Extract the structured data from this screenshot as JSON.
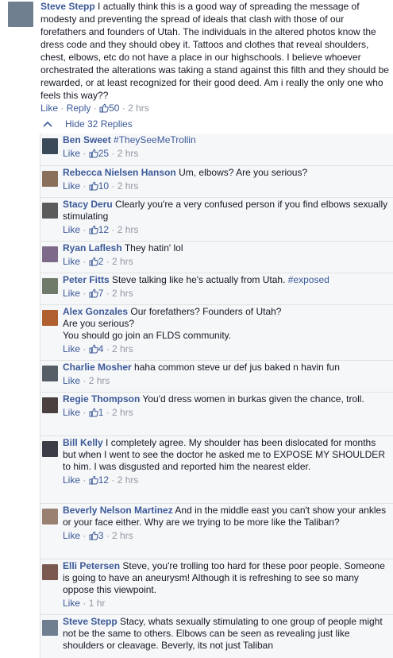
{
  "main_comment": {
    "author": "Steve Stepp",
    "text": "I actually think this is a good way of spreading the message of modesty and preventing the spread of ideals that clash with those of our forefathers and founders of Utah. The individuals in the altered photos know the dress code and they should obey it. Tattoos and clothes that reveal shoulders, chest, elbows, etc do not have a place in our highschools. I believe whoever orchestrated the alterations was taking a stand against this filth and they should be rewarded, or at least recognized for their good deed. Am i really the only one who feels this way??",
    "like_label": "Like",
    "reply_label": "Reply",
    "likes": "50",
    "time": "2 hrs"
  },
  "hide_replies_label": "Hide 32 Replies",
  "replies": [
    {
      "author": "Ben Sweet",
      "text": "",
      "hashtag": "#TheySeeMeTrollin",
      "like_label": "Like",
      "likes": "25",
      "time": "2 hrs",
      "avatar_color": "#3a4a58"
    },
    {
      "author": "Rebecca Nielsen Hanson",
      "text": "Um, elbows? Are you serious?",
      "hashtag": "",
      "like_label": "Like",
      "likes": "10",
      "time": "2 hrs",
      "avatar_color": "#8a6f5a"
    },
    {
      "author": "Stacy Deru",
      "text": "Clearly you're a very confused person if you find elbows sexually stimulating",
      "hashtag": "",
      "like_label": "Like",
      "likes": "12",
      "time": "2 hrs",
      "avatar_color": "#5b5b5b"
    },
    {
      "author": "Ryan Laflesh",
      "text": "They hatin' lol",
      "hashtag": "",
      "like_label": "Like",
      "likes": "2",
      "time": "2 hrs",
      "avatar_color": "#7d6a8a"
    },
    {
      "author": "Peter Fitts",
      "text": "Steve talking like he's actually from Utah.",
      "hashtag": "#exposed",
      "like_label": "Like",
      "likes": "7",
      "time": "2 hrs",
      "avatar_color": "#6f7a6a"
    },
    {
      "author": "Alex Gonzales",
      "text": "Our forefathers? Founders of Utah?\nAre you serious?\nYou should go join an FLDS community.",
      "hashtag": "",
      "like_label": "Like",
      "likes": "4",
      "time": "2 hrs",
      "avatar_color": "#b0602e"
    },
    {
      "author": "Charlie Mosher",
      "text": "haha common steve ur def jus baked n havin fun",
      "hashtag": "",
      "like_label": "Like",
      "likes": "",
      "time": "2 hrs",
      "avatar_color": "#555e66"
    },
    {
      "author": "Regie Thompson",
      "text": "You'd dress women in burkas given the chance, troll.",
      "hashtag": "",
      "like_label": "Like",
      "likes": "1",
      "time": "2 hrs",
      "avatar_color": "#4a4040"
    },
    {
      "author": "Bill Kelly",
      "text": "I completely agree. My shoulder has been dislocated for months but when I went to see the doctor he asked me to EXPOSE MY SHOULDER to him. I was disgusted and reported him the nearest elder.",
      "hashtag": "",
      "like_label": "Like",
      "likes": "12",
      "time": "2 hrs",
      "avatar_color": "#3c3c48"
    },
    {
      "author": "Beverly Nelson Martinez",
      "text": "And in the middle east you can't show your ankles or your face either. Why are we trying to be more like the Taliban?",
      "hashtag": "",
      "like_label": "Like",
      "likes": "3",
      "time": "2 hrs",
      "avatar_color": "#9a8070"
    },
    {
      "author": "Elli Petersen",
      "text": "Steve, you're trolling too hard for these poor people. Someone is going to have an aneurysm! Although it is refreshing to see so many oppose this viewpoint.",
      "hashtag": "",
      "like_label": "Like",
      "likes": "",
      "time": "1 hr",
      "avatar_color": "#7a5a50"
    },
    {
      "author": "Steve Stepp",
      "text": "Stacy, whats sexually stimulating to one group of people might not be the same to others. Elbows can be seen as revealing just like shoulders or cleavage. Beverly, its not just Taliban",
      "hashtag": "",
      "like_label": "",
      "likes": "",
      "time": "",
      "avatar_color": "#6f7f8f"
    }
  ]
}
